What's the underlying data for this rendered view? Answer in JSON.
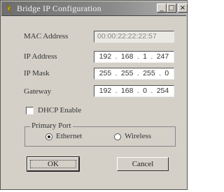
{
  "window": {
    "title": "Bridge IP Configuration",
    "controls": {
      "minimize": "_",
      "maximize": "□",
      "close": "×"
    }
  },
  "fields": {
    "mac": {
      "label": "MAC Address",
      "value": "00:00:22:22:22:57"
    },
    "ip": {
      "label": "IP Address",
      "octets": [
        "192",
        "168",
        "1",
        "247"
      ]
    },
    "mask": {
      "label": "IP Mask",
      "octets": [
        "255",
        "255",
        "255",
        "0"
      ]
    },
    "gateway": {
      "label": "Gateway",
      "octets": [
        "192",
        "168",
        "0",
        "254"
      ]
    }
  },
  "dhcp": {
    "label": "DHCP Enable",
    "checked": false
  },
  "primary_port": {
    "legend": "Primary Port",
    "options": [
      {
        "label": "Ethernet",
        "selected": true
      },
      {
        "label": "Wireless",
        "selected": false
      }
    ]
  },
  "buttons": {
    "ok": "OK",
    "cancel": "Cancel"
  },
  "icons": {
    "app": "app-icon",
    "minimize": "minimize-icon",
    "maximize": "maximize-icon",
    "close": "close-icon"
  }
}
